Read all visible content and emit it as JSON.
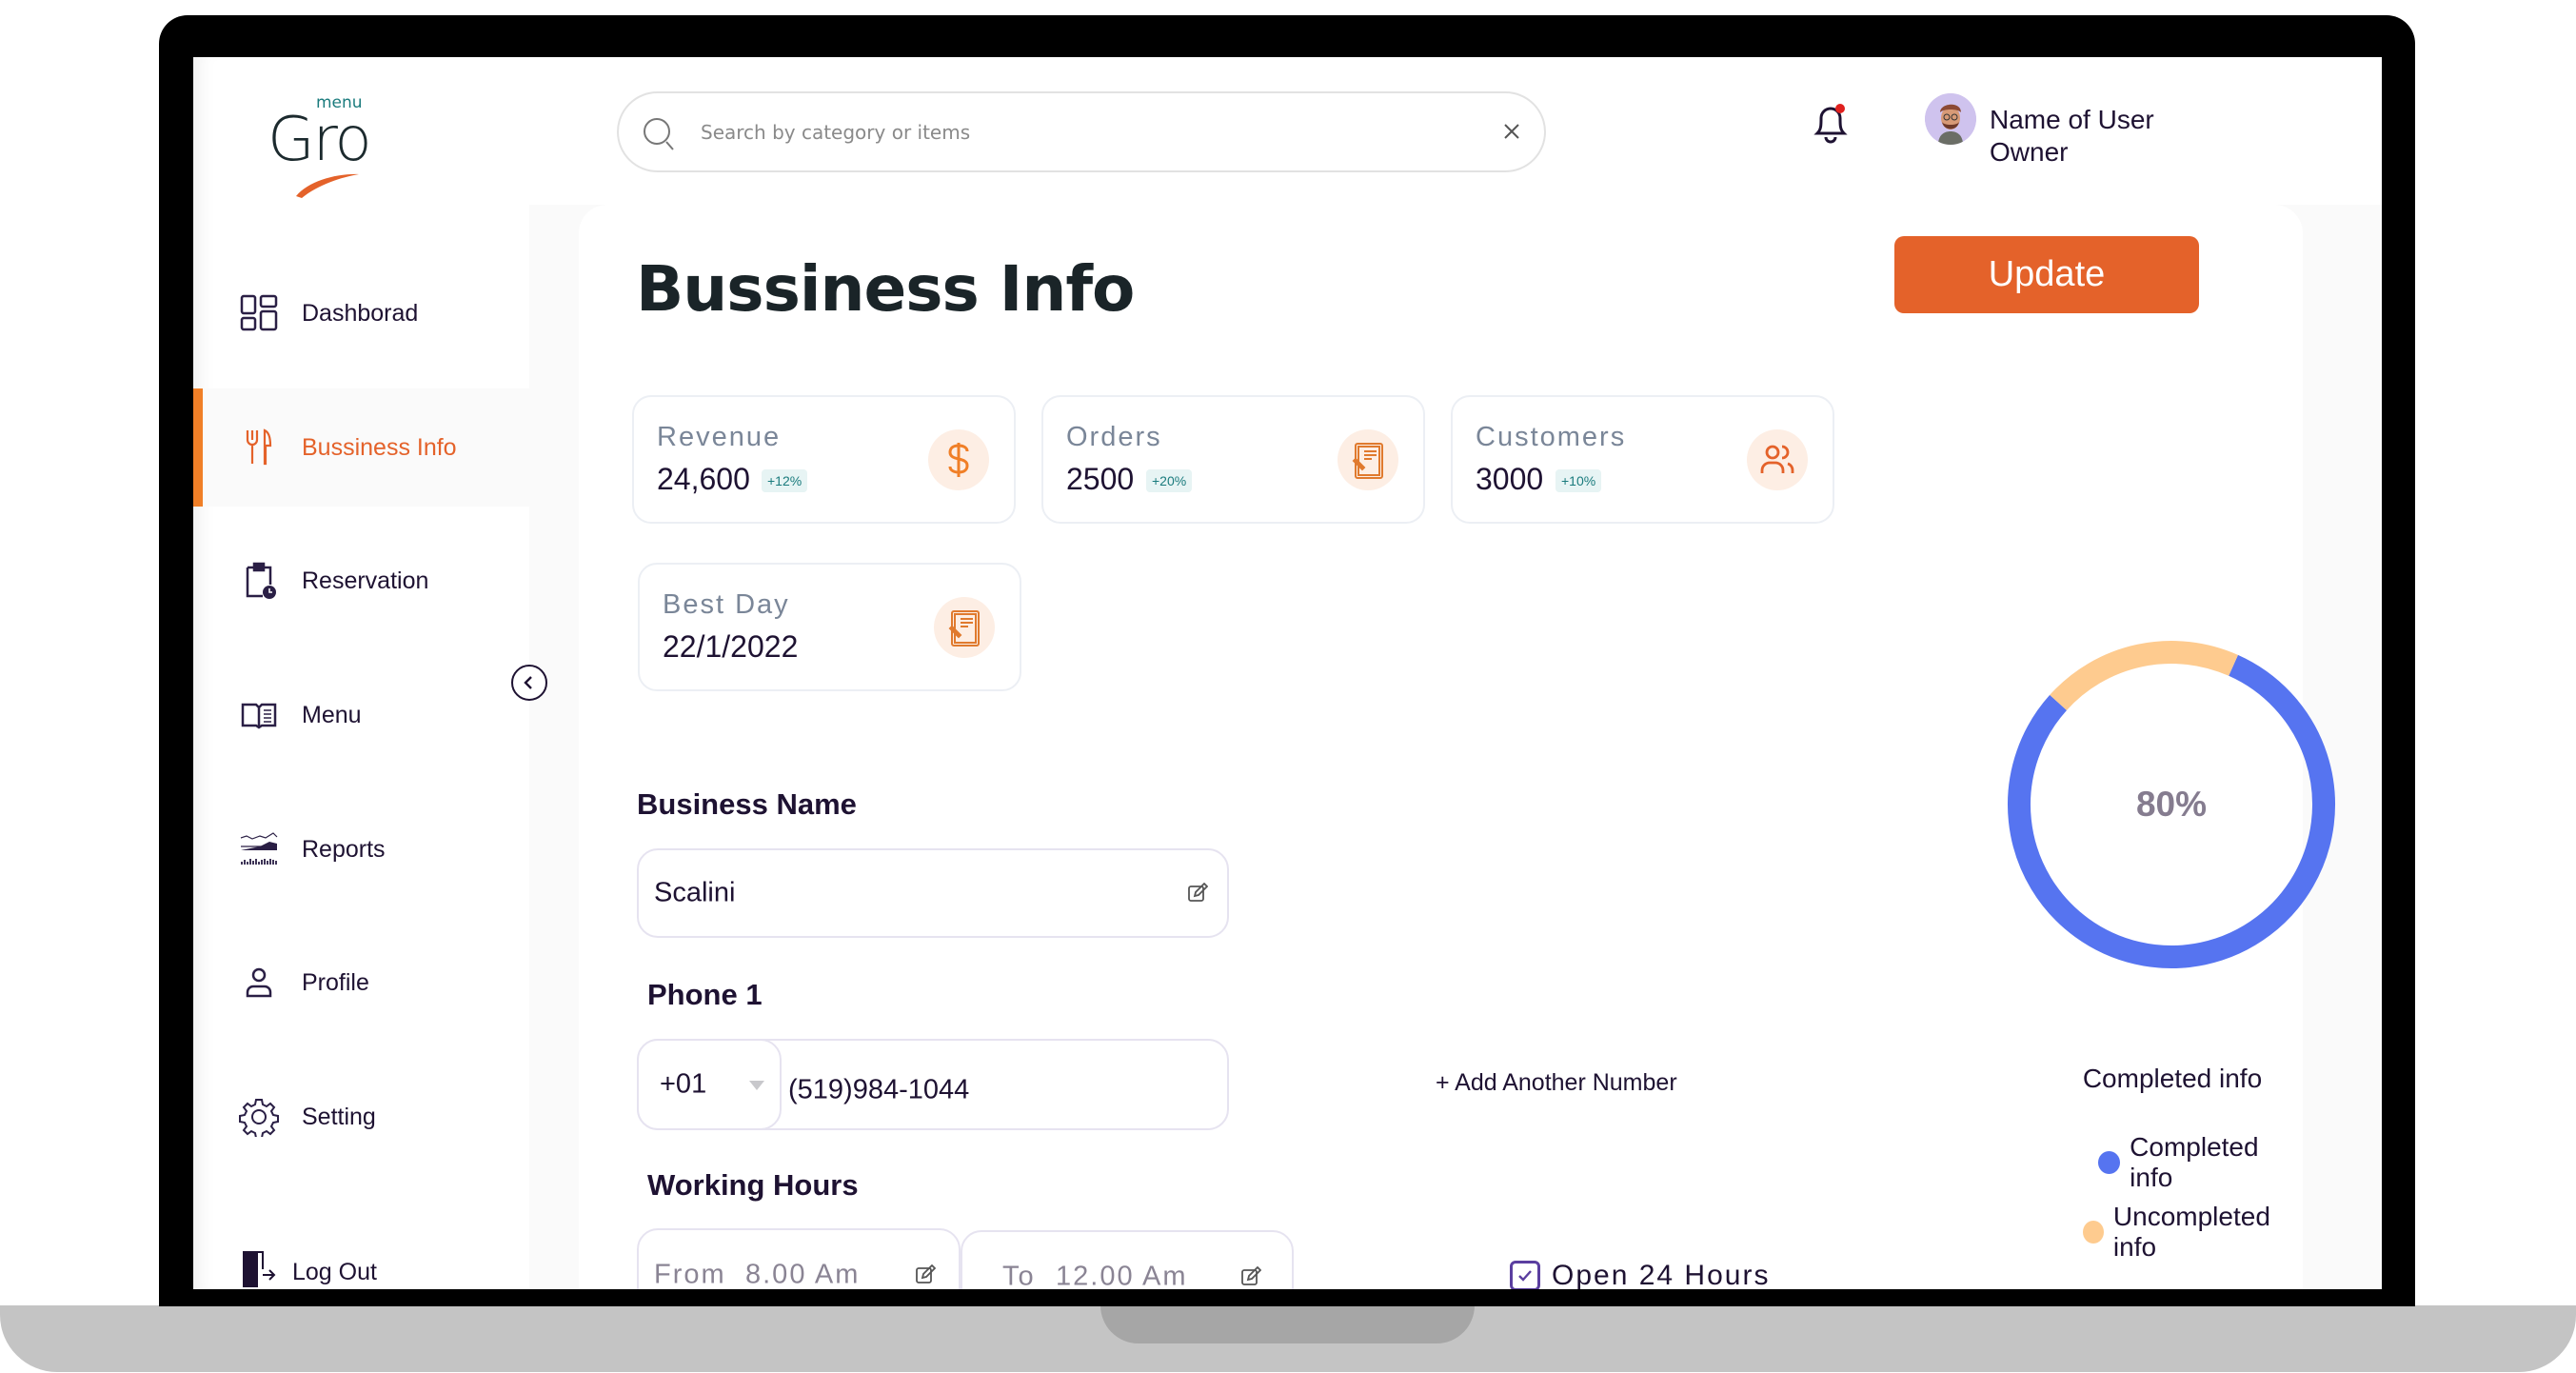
{
  "app": {
    "logo_main": "Gro",
    "logo_sub": "menu",
    "brand_color": "#e4622a"
  },
  "search": {
    "placeholder": "Search by category or items",
    "value": ""
  },
  "user": {
    "name": "Name of User",
    "role": "Owner",
    "has_notification": true
  },
  "sidebar": {
    "items": [
      {
        "label": "Dashborad",
        "icon": "dashboard-grid-icon",
        "active": false
      },
      {
        "label": "Bussiness Info",
        "icon": "fork-knife-icon",
        "active": true
      },
      {
        "label": "Reservation",
        "icon": "clipboard-clock-icon",
        "active": false
      },
      {
        "label": "Menu",
        "icon": "open-book-icon",
        "active": false
      },
      {
        "label": "Reports",
        "icon": "reports-chart-icon",
        "active": false
      },
      {
        "label": "Profile",
        "icon": "user-icon",
        "active": false
      },
      {
        "label": "Setting",
        "icon": "gear-icon",
        "active": false
      },
      {
        "label": "Log Out",
        "icon": "logout-icon",
        "active": false
      }
    ]
  },
  "main": {
    "title": "Bussiness Info",
    "update_label": "Update",
    "stats": [
      {
        "label": "Revenue",
        "value": "24,600",
        "badge": "+12%",
        "icon": "dollar-icon"
      },
      {
        "label": "Orders",
        "value": "2500",
        "badge": "+20%",
        "icon": "clipboard-icon"
      },
      {
        "label": "Customers",
        "value": "3000",
        "badge": "+10%",
        "icon": "users-icon"
      },
      {
        "label": "Best Day",
        "value": "22/1/2022",
        "badge": null,
        "icon": "clipboard-icon"
      }
    ],
    "business_name": {
      "label": "Business Name",
      "value": "Scalini"
    },
    "phone": {
      "label": "Phone 1",
      "country_code": "+01",
      "number": "(519)984-1044",
      "add_another_label": "+ Add Another Number"
    },
    "working_hours": {
      "label": "Working Hours",
      "from_label": "From",
      "from_value": "8.00 Am",
      "to_label": "To",
      "to_value": "12.00 Am",
      "open_24_label": "Open 24 Hours",
      "open_24_checked": true
    }
  },
  "chart_data": {
    "type": "pie",
    "title": "Completed info",
    "center_label": "80%",
    "categories": [
      "Completed info",
      "Uncompleted info"
    ],
    "values": [
      80,
      20
    ],
    "colors": [
      "#5674f0",
      "#fecb8f"
    ],
    "legend_placement": "bottom"
  }
}
